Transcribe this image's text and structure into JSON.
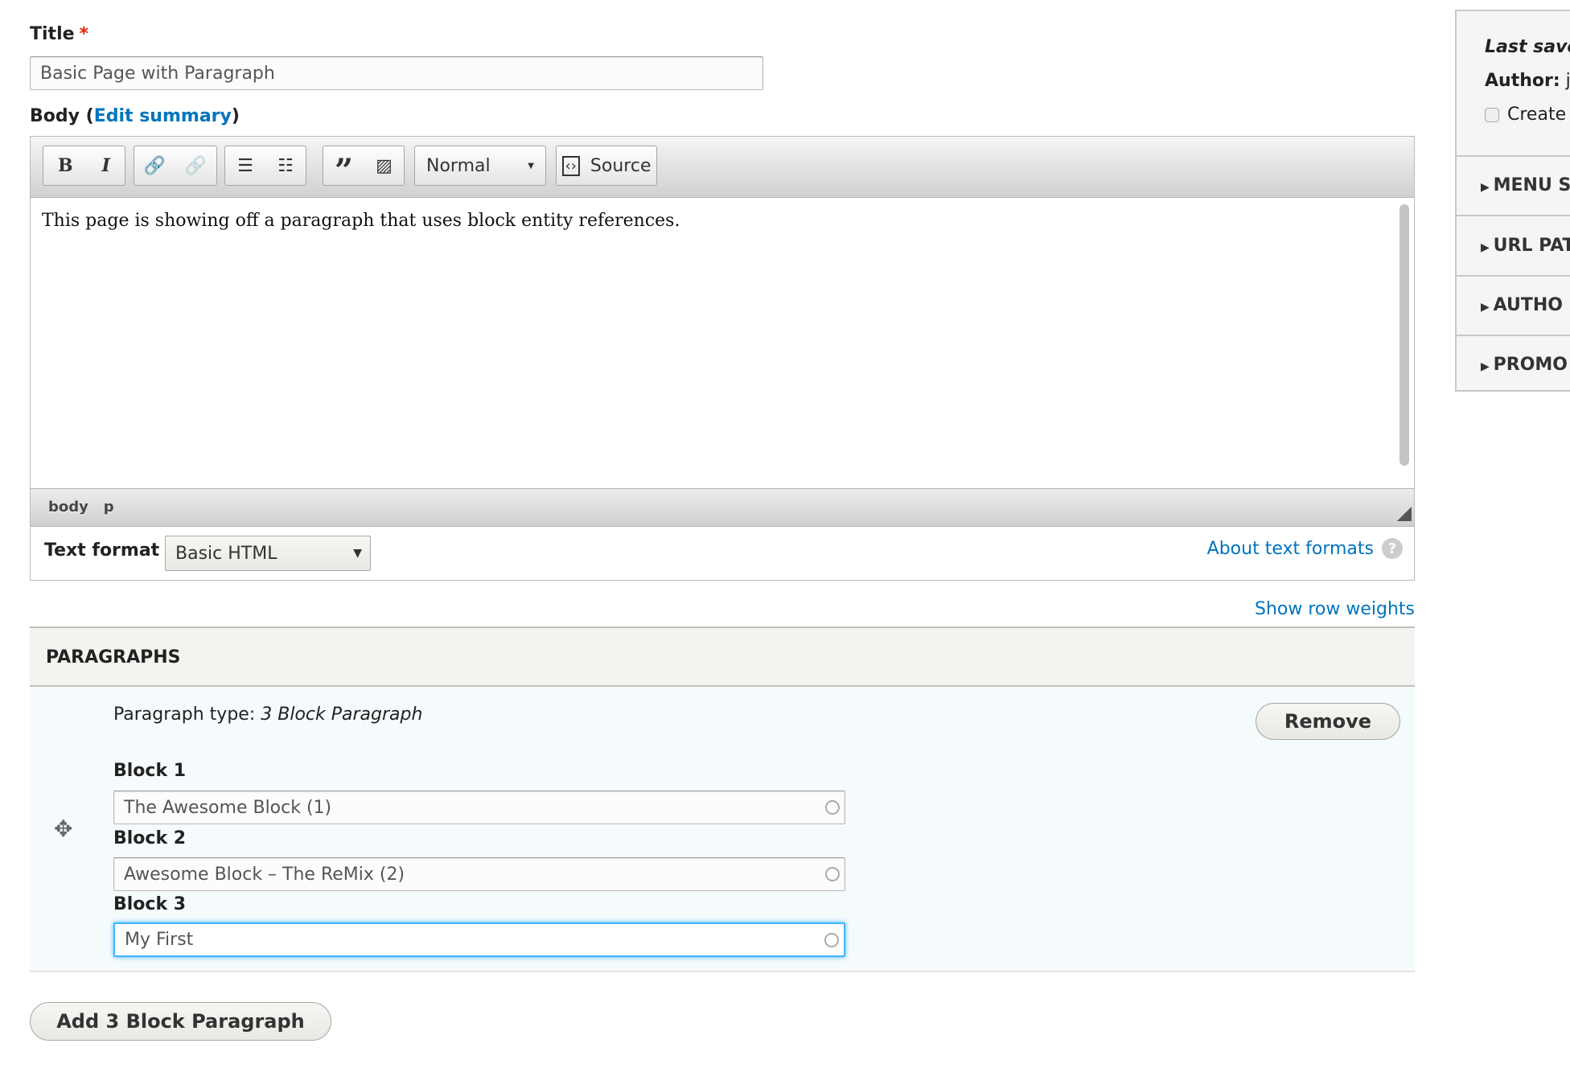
{
  "title_field": {
    "label": "Title",
    "required_mark": "*",
    "value": "Basic Page with Paragraph"
  },
  "body_field": {
    "label": "Body",
    "edit_summary": "Edit summary",
    "open_paren": "(",
    "close_paren": ")"
  },
  "toolbar": {
    "bold": "B",
    "italic": "I",
    "format_select": "Normal",
    "source": "Source"
  },
  "editor": {
    "content": "This page is showing off a paragraph that uses block entity references.",
    "path": [
      "body",
      "p"
    ]
  },
  "text_format": {
    "label": "Text format",
    "value": "Basic HTML",
    "about_link": "About text formats"
  },
  "show_row_weights": "Show row weights",
  "paragraphs": {
    "header": "PARAGRAPHS",
    "type_label": "Paragraph type:",
    "type_value": "3 Block Paragraph",
    "remove": "Remove",
    "blocks": [
      {
        "label": "Block 1",
        "value": "The Awesome Block (1)"
      },
      {
        "label": "Block 2",
        "value": "Awesome Block – The ReMix (2)"
      },
      {
        "label": "Block 3",
        "value": "My First"
      }
    ],
    "add_button": "Add 3 Block Paragraph"
  },
  "sidebar": {
    "last_saved": "Last save",
    "author_label": "Author:",
    "author_value": "j",
    "create_label": "Create",
    "sections": [
      "MENU S",
      "URL PAT",
      "AUTHO",
      "PROMO"
    ]
  },
  "colors": {
    "link": "#0074bd",
    "required": "#e62600",
    "focus": "#40b6ff"
  }
}
